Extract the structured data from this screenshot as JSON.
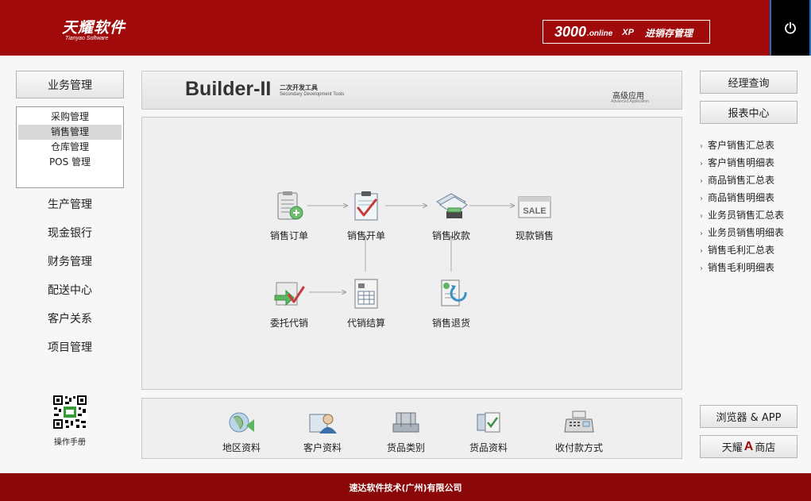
{
  "header": {
    "logo_cn": "天耀软件",
    "logo_en": "Tianyao Software",
    "product_number": "3000",
    "product_suffix": ".online",
    "product_xp": "XP",
    "product_name": "进销存管理"
  },
  "left": {
    "top_button": "业务管理",
    "submenu": [
      {
        "label": "采购管理"
      },
      {
        "label": "销售管理"
      },
      {
        "label": "仓库管理"
      },
      {
        "label": "POS 管理"
      }
    ],
    "nav": [
      {
        "label": "生产管理"
      },
      {
        "label": "现金银行"
      },
      {
        "label": "财务管理"
      },
      {
        "label": "配送中心"
      },
      {
        "label": "客户关系"
      },
      {
        "label": "项目管理"
      }
    ],
    "manual_label": "操作手册"
  },
  "banner": {
    "builder": "Builder-II",
    "sub_cn": "二次开发工具",
    "sub_en": "Secondary Development Tools",
    "adv_cn": "高级应用",
    "adv_en": "Advanced Application"
  },
  "flow": {
    "nodes": [
      {
        "label": "销售订单"
      },
      {
        "label": "销售开单"
      },
      {
        "label": "销售收款"
      },
      {
        "label": "现款销售"
      },
      {
        "label": "委托代销"
      },
      {
        "label": "代销结算"
      },
      {
        "label": "销售退货"
      }
    ],
    "sale_badge": "SALE"
  },
  "bottom": {
    "items": [
      {
        "label": "地区资料"
      },
      {
        "label": "客户资料"
      },
      {
        "label": "货品类别"
      },
      {
        "label": "货品资料"
      },
      {
        "label": "收付款方式"
      }
    ]
  },
  "right": {
    "manager_query": "经理查询",
    "report_center": "报表中心",
    "reports": [
      {
        "label": "客户销售汇总表"
      },
      {
        "label": "客户销售明细表"
      },
      {
        "label": "商品销售汇总表"
      },
      {
        "label": "商品销售明细表"
      },
      {
        "label": "业务员销售汇总表"
      },
      {
        "label": "业务员销售明细表"
      },
      {
        "label": "销售毛利汇总表"
      },
      {
        "label": "销售毛利明细表"
      }
    ],
    "browser_app": "浏览器 & APP",
    "store_prefix": "天耀",
    "store_a": "A",
    "store_suffix": "商店"
  },
  "footer": {
    "company": "速达软件技术(广州)有限公司"
  },
  "colors": {
    "brand_red": "#a00a0a",
    "footer_red": "#8a0808",
    "accent_green": "#5cb85c"
  }
}
